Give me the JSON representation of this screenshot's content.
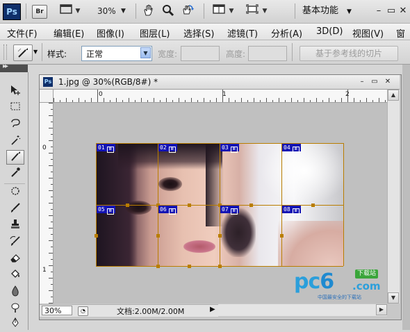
{
  "appbar": {
    "logo": "Ps",
    "bridge_label": "Br",
    "zoom": "30%",
    "workspace": "基本功能",
    "icons": [
      "screen-mode-icon",
      "hand-icon",
      "zoom-icon",
      "rotate-view-icon",
      "arrange-documents-icon",
      "screen-mode-icon"
    ]
  },
  "menu": [
    {
      "label": "文件(F)"
    },
    {
      "label": "编辑(E)"
    },
    {
      "label": "图像(I)"
    },
    {
      "label": "图层(L)"
    },
    {
      "label": "选择(S)"
    },
    {
      "label": "滤镜(T)"
    },
    {
      "label": "分析(A)"
    },
    {
      "label": "3D(D)"
    },
    {
      "label": "视图(V)"
    },
    {
      "label": "窗"
    }
  ],
  "options": {
    "style_label": "样式:",
    "style_value": "正常",
    "width_label": "宽度:",
    "height_label": "高度:",
    "slices_from_guides": "基于参考线的切片"
  },
  "document": {
    "title": "1.jpg @ 30%(RGB/8#) *",
    "ps_icon": "Ps",
    "ruler_h_labels": [
      "0",
      "1",
      "2"
    ],
    "ruler_v_labels": [
      "0",
      "1"
    ],
    "slices": [
      "01",
      "02",
      "03",
      "04",
      "05",
      "06",
      "07",
      "08"
    ],
    "zoom": "30%",
    "doc_size": "文档:2.00M/2.00M"
  },
  "watermark": {
    "brand_pc": "pc",
    "brand_6": "6",
    "brand_com": ".com",
    "badge": "下载站",
    "tagline": "中国最安全的下载站"
  }
}
